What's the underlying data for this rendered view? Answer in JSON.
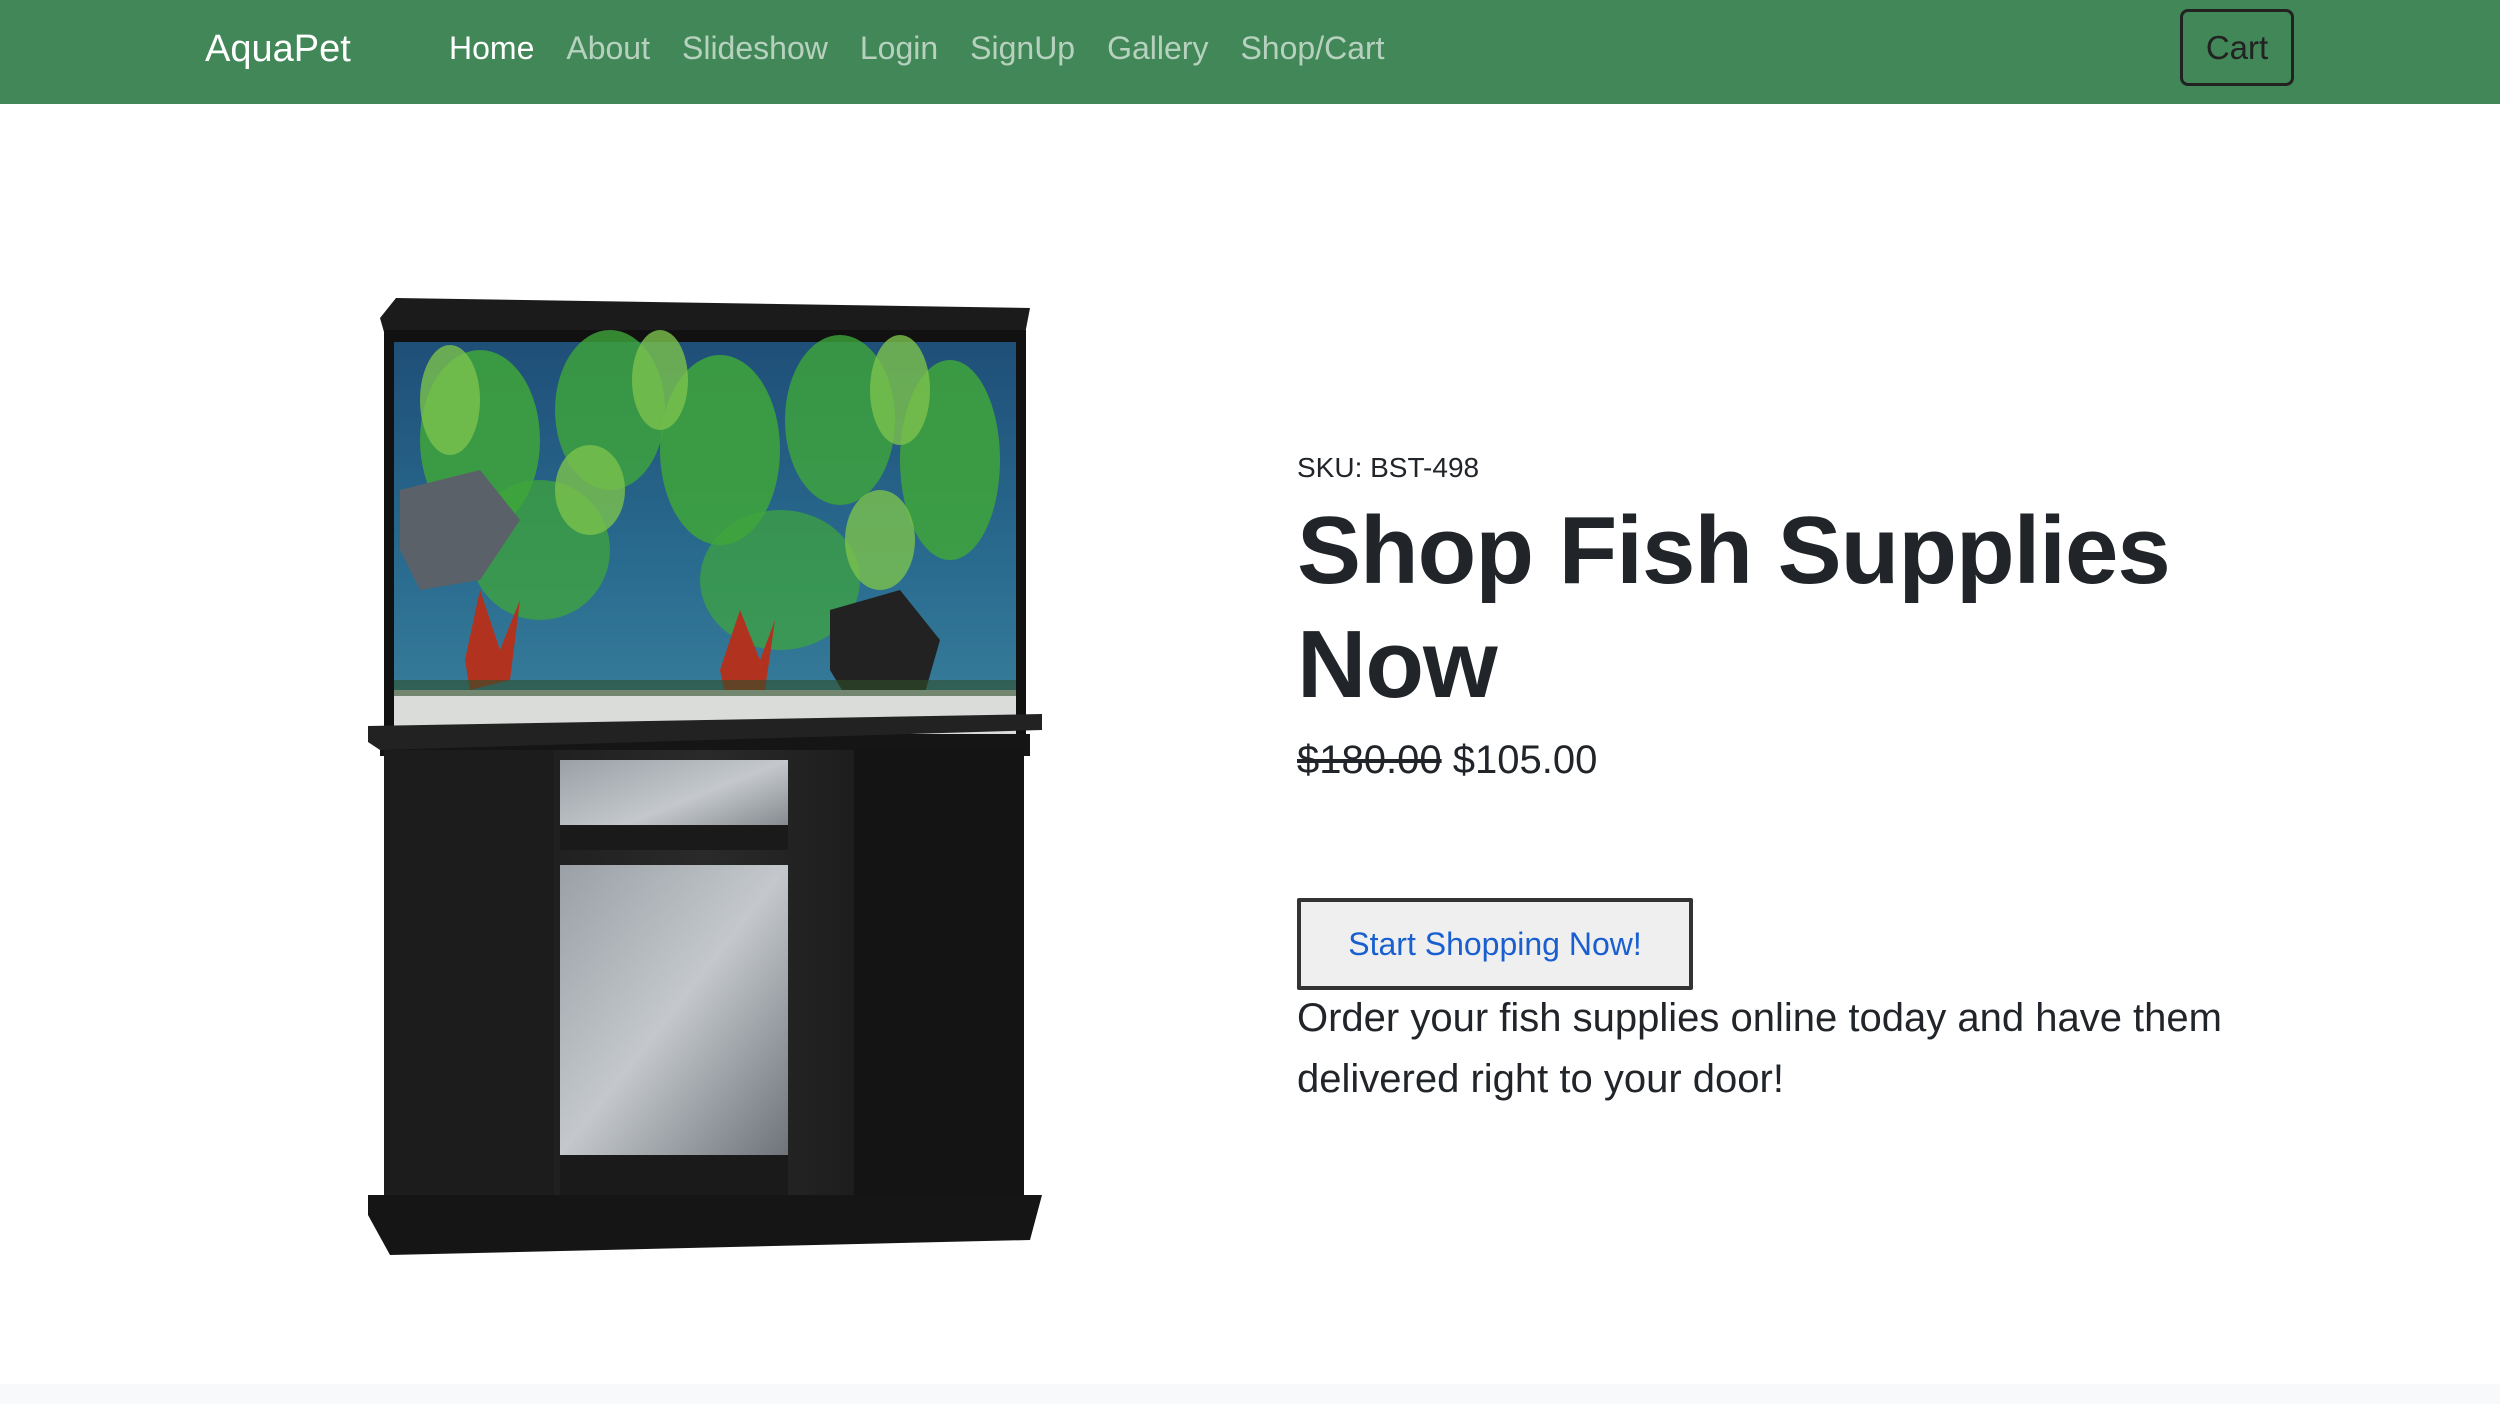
{
  "navbar": {
    "brand": "AquaPet",
    "links": [
      {
        "label": "Home",
        "active": true
      },
      {
        "label": "About"
      },
      {
        "label": "Slideshow"
      },
      {
        "label": "Login"
      },
      {
        "label": "SignUp"
      },
      {
        "label": "Gallery"
      },
      {
        "label": "Shop/Cart"
      }
    ],
    "cart_label": "Cart",
    "background_color": "#428757"
  },
  "product": {
    "image_alt": "aquarium-with-stand",
    "sku": "SKU: BST-498",
    "title": "Shop Fish Supplies Now",
    "old_price": "$180.00",
    "new_price": "$105.00",
    "cta_label": "Start Shopping Now!",
    "description": "Order your fish supplies online today and have them delivered right to your door!"
  }
}
